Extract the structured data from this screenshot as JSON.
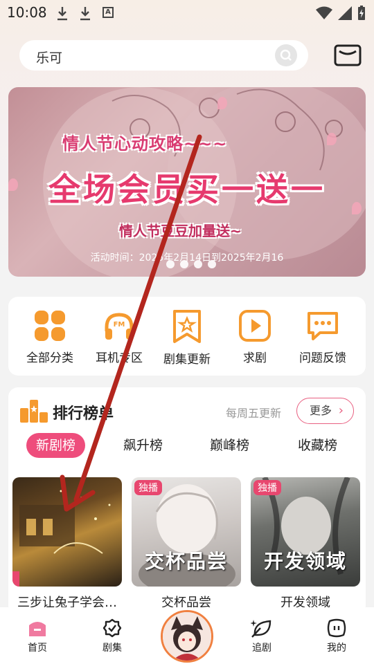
{
  "status_bar": {
    "time": "10:08",
    "a_icon": "A"
  },
  "search": {
    "value": "乐可"
  },
  "banner": {
    "line1": "情人节心动攻略~~~",
    "line2": "全场会员买一送一",
    "line3": "情人节豆豆加量送~",
    "line4": "活动时间：2025年2月14日到2025年2月16",
    "slides": 4,
    "active_slide": 1
  },
  "quick_actions": [
    {
      "label": "全部分类",
      "icon": "grid-icon"
    },
    {
      "label": "耳机专区",
      "icon": "headphones-icon"
    },
    {
      "label": "剧集更新",
      "icon": "bookmark-star-icon"
    },
    {
      "label": "求剧",
      "icon": "play-box-icon"
    },
    {
      "label": "问题反馈",
      "icon": "chat-bubble-icon"
    }
  ],
  "ranking": {
    "title": "排行榜单",
    "update_note": "每周五更新",
    "more_label": "更多",
    "tabs": [
      "新剧榜",
      "飙升榜",
      "巅峰榜",
      "收藏榜"
    ],
    "active_tab": 0,
    "cards": [
      {
        "name": "三步让兔子学会…",
        "badge": "",
        "cover_text": ""
      },
      {
        "name": "交杯品尝",
        "badge": "独播",
        "cover_text": "交杯品尝"
      },
      {
        "name": "开发领域",
        "badge": "独播",
        "cover_text": "开发领域"
      }
    ]
  },
  "bottom_nav": [
    {
      "label": "首页",
      "icon": "home-icon",
      "active": true
    },
    {
      "label": "剧集",
      "icon": "badge-icon",
      "active": false
    },
    {
      "label": "",
      "icon": "avatar",
      "active": false
    },
    {
      "label": "追剧",
      "icon": "leaf-icon",
      "active": false
    },
    {
      "label": "我的",
      "icon": "face-icon",
      "active": false
    }
  ],
  "colors": {
    "accent_pink": "#ee4d7c",
    "accent_orange": "#f08a2a",
    "arrow_red": "#b3261e"
  }
}
